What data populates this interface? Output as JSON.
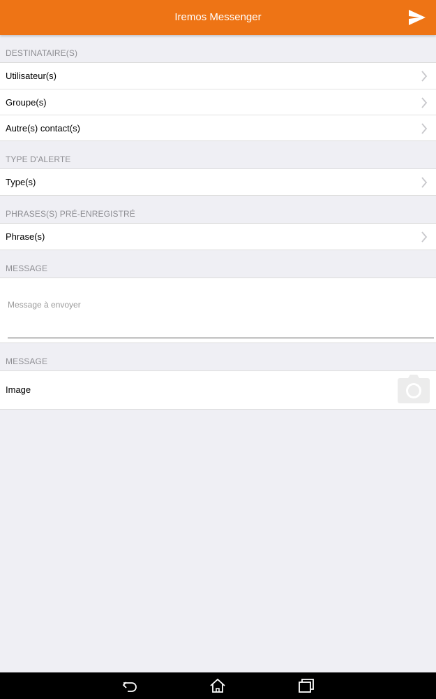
{
  "header": {
    "title": "Iremos Messenger",
    "send_icon": "send-icon"
  },
  "colors": {
    "accent": "#ee7415",
    "background": "#efeff4",
    "section_text": "#8e8e93"
  },
  "sections": {
    "recipients": {
      "title": "DESTINATAIRE(S)",
      "items": [
        {
          "label": "Utilisateur(s)"
        },
        {
          "label": "Groupe(s)"
        },
        {
          "label": "Autre(s) contact(s)"
        }
      ]
    },
    "alert_type": {
      "title": "TYPE D'ALERTE",
      "items": [
        {
          "label": "Type(s)"
        }
      ]
    },
    "phrases": {
      "title": "PHRASES(S) PRÉ-ENREGISTRÉ",
      "items": [
        {
          "label": "Phrase(s)"
        }
      ]
    },
    "message": {
      "title": "MESSAGE",
      "value": "",
      "placeholder": "Message à envoyer"
    },
    "media": {
      "title": "MESSAGE",
      "image_label": "Image",
      "camera_icon": "camera-icon"
    }
  },
  "nav": {
    "icons": [
      "back-icon",
      "home-icon",
      "recent-apps-icon"
    ]
  }
}
